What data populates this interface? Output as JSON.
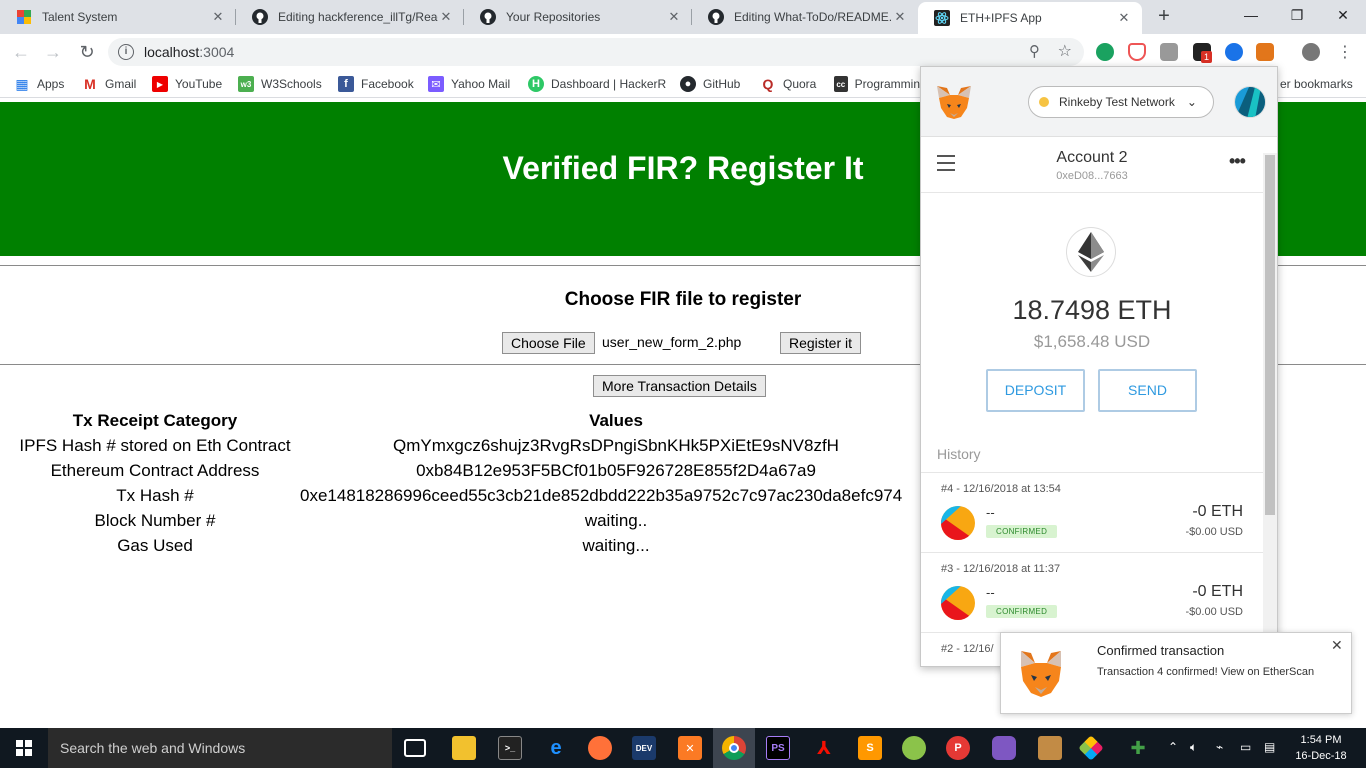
{
  "browser": {
    "tabs": [
      {
        "title": "Talent System",
        "icon": "talent-system-icon"
      },
      {
        "title": "Editing hackference_illTg/Read",
        "icon": "github-icon"
      },
      {
        "title": "Your Repositories",
        "icon": "github-icon"
      },
      {
        "title": "Editing What-ToDo/README.m",
        "icon": "github-icon"
      },
      {
        "title": "ETH+IPFS App",
        "icon": "react-icon"
      }
    ],
    "url_host": "localhost",
    "url_port": ":3004",
    "bookmarks": [
      {
        "label": "Apps"
      },
      {
        "label": "Gmail"
      },
      {
        "label": "YouTube"
      },
      {
        "label": "W3Schools"
      },
      {
        "label": "Facebook"
      },
      {
        "label": "Yahoo Mail"
      },
      {
        "label": "Dashboard | HackerR"
      },
      {
        "label": "GitHub"
      },
      {
        "label": "Quora"
      },
      {
        "label": "Programmin"
      },
      {
        "label": "er bookmarks"
      }
    ],
    "extension_badge": "1"
  },
  "page": {
    "banner_title": "Verified FIR? Register It",
    "choose_title": "Choose FIR file to register",
    "choose_file_label": "Choose File",
    "file_name": "user_new_form_2.php",
    "register_label": "Register it",
    "more_details_label": "More Transaction Details",
    "table": {
      "headers": [
        "Tx Receipt Category",
        "Values"
      ],
      "rows": [
        {
          "category": "IPFS Hash # stored on Eth Contract",
          "value": "QmYmxgcz6shujz3RvgRsDPngiSbnKHk5PXiEtE9sNV8zfH"
        },
        {
          "category": "Ethereum Contract Address",
          "value": "0xb84B12e953F5BCf01b05F926728E855f2D4a67a9"
        },
        {
          "category": "Tx Hash #",
          "value": "0xe14818286996ceed55c3cb21de852dbdd222b35a9752c7c97ac230da8efc974"
        },
        {
          "category": "Block Number #",
          "value": "waiting.."
        },
        {
          "category": "Gas Used",
          "value": "waiting..."
        }
      ]
    }
  },
  "metamask": {
    "network": "Rinkeby Test Network",
    "network_color": "#f6c343",
    "account_name": "Account 2",
    "account_address": "0xeD08...7663",
    "balance": "18.7498 ETH",
    "balance_usd": "$1,658.48 USD",
    "deposit_label": "DEPOSIT",
    "send_label": "SEND",
    "history_label": "History",
    "history": [
      {
        "date": "#4 - 12/16/2018 at 13:54",
        "dash": "--",
        "status": "CONFIRMED",
        "amount": "-0 ETH",
        "usd": "-$0.00 USD"
      },
      {
        "date": "#3 - 12/16/2018 at 11:37",
        "dash": "--",
        "status": "CONFIRMED",
        "amount": "-0 ETH",
        "usd": "-$0.00 USD"
      },
      {
        "date": "#2 - 12/16/",
        "dash": "",
        "status": "",
        "amount": "",
        "usd": ""
      }
    ]
  },
  "notification": {
    "title": "Confirmed transaction",
    "body": "Transaction 4 confirmed! View on EtherScan"
  },
  "taskbar": {
    "search_placeholder": "Search the web and Windows",
    "time": "1:54 PM",
    "date": "16-Dec-18"
  },
  "colors": {
    "banner": "#008000",
    "metamask_blue": "#2f9ae0",
    "taskbar": "#101820"
  }
}
